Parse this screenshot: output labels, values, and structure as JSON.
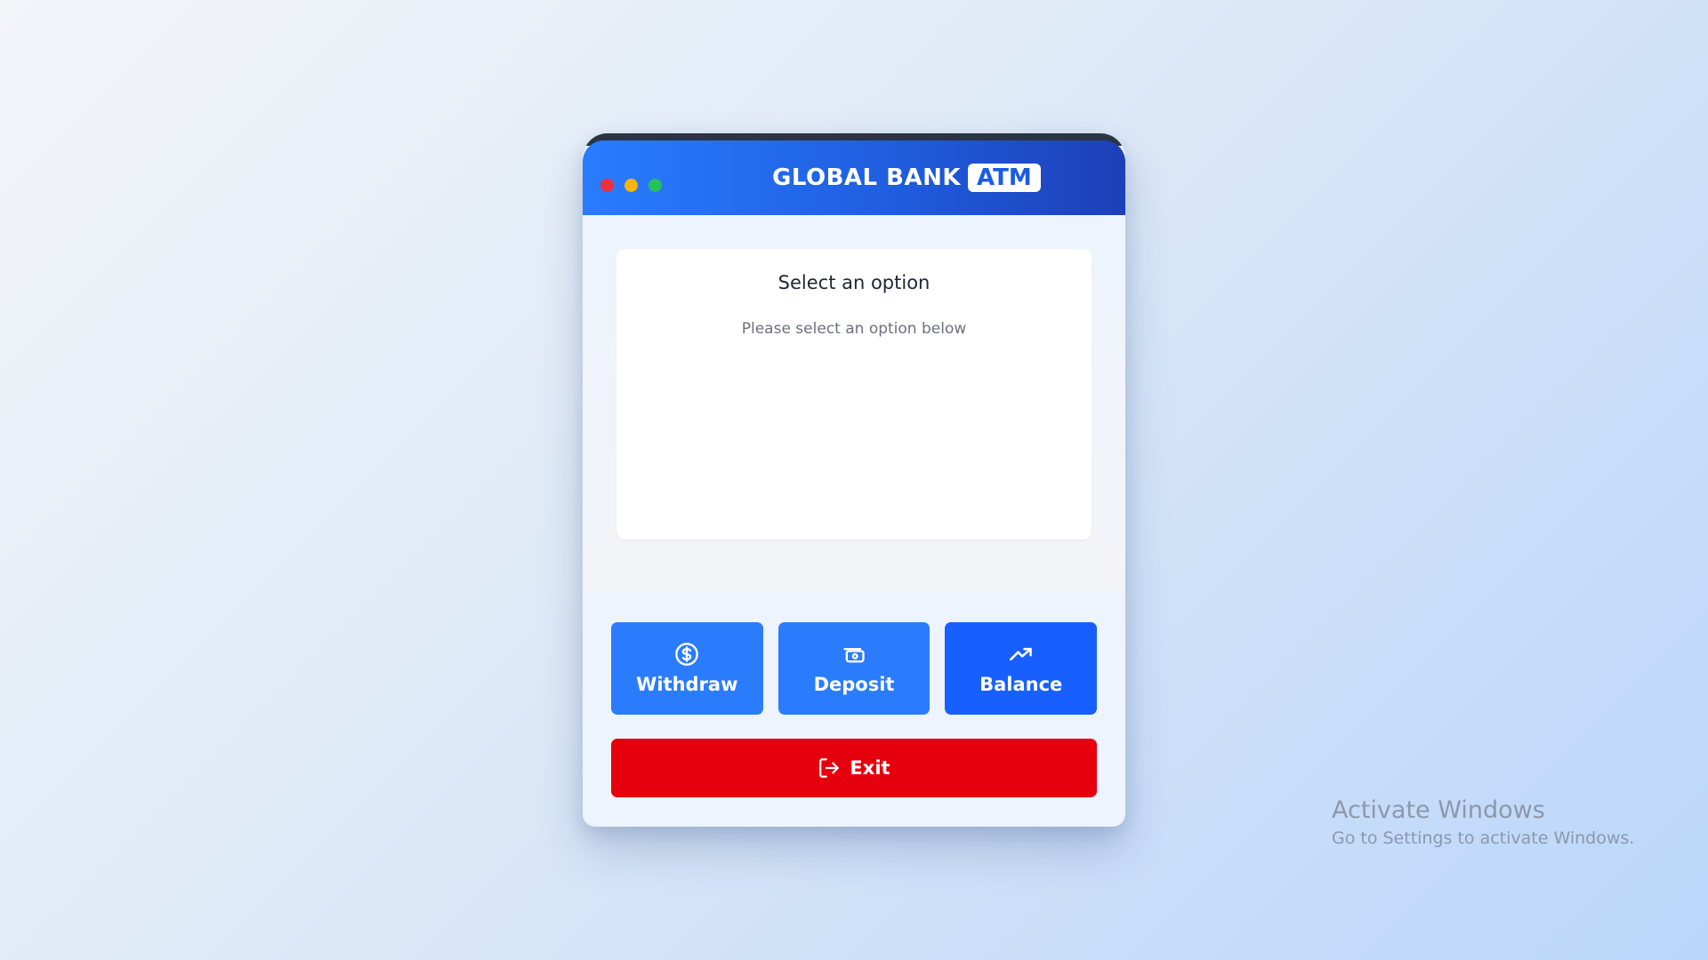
{
  "app": {
    "brand_name": "GLOBAL BANK",
    "brand_badge": "ATM"
  },
  "window_controls": [
    "close",
    "minimize",
    "maximize"
  ],
  "screen": {
    "title": "Select an option",
    "subtitle": "Please select an option below"
  },
  "options": [
    {
      "label": "Withdraw",
      "icon": "dollar-circle-icon"
    },
    {
      "label": "Deposit",
      "icon": "banknote-icon"
    },
    {
      "label": "Balance",
      "icon": "trending-up-icon"
    }
  ],
  "exit": {
    "label": "Exit",
    "icon": "log-out-icon"
  },
  "os_watermark": {
    "title": "Activate Windows",
    "subtitle": "Go to Settings to activate Windows."
  },
  "colors": {
    "header_start": "#2a7cff",
    "header_end": "#1d3fb7",
    "button": "#2b7cfd",
    "button_active": "#1760ff",
    "exit": "#e6000e"
  }
}
